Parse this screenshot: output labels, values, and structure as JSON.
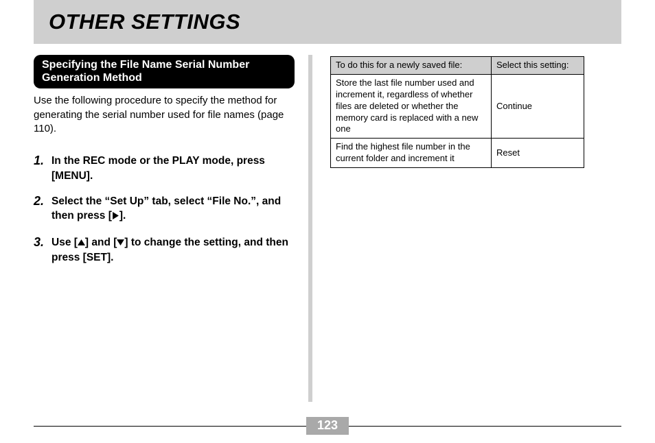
{
  "title": "OTHER SETTINGS",
  "subheading": "Specifying the File Name Serial Number Generation Method",
  "intro": "Use the following procedure to specify the method for generating the serial number used for file names (page 110).",
  "steps": [
    {
      "num": "1.",
      "text_pre": "In the REC mode or the PLAY mode, press [MENU]."
    },
    {
      "num": "2.",
      "text_pre": "Select the “Set Up” tab, select “File No.”, and then press [",
      "icon": "right",
      "text_post": "]."
    },
    {
      "num": "3.",
      "text_pre": "Use [",
      "icon": "up",
      "mid": "] and [",
      "icon2": "down",
      "text_post": "] to change the setting, and then press [SET]."
    }
  ],
  "table": {
    "headers": [
      "To do this for a newly saved file:",
      "Select this setting:"
    ],
    "rows": [
      [
        "Store the last file number used and increment it, regardless of whether files are deleted or whether the memory card is replaced with a new one",
        "Continue"
      ],
      [
        "Find the highest file number in the current folder and increment it",
        "Reset"
      ]
    ]
  },
  "page_number": "123"
}
